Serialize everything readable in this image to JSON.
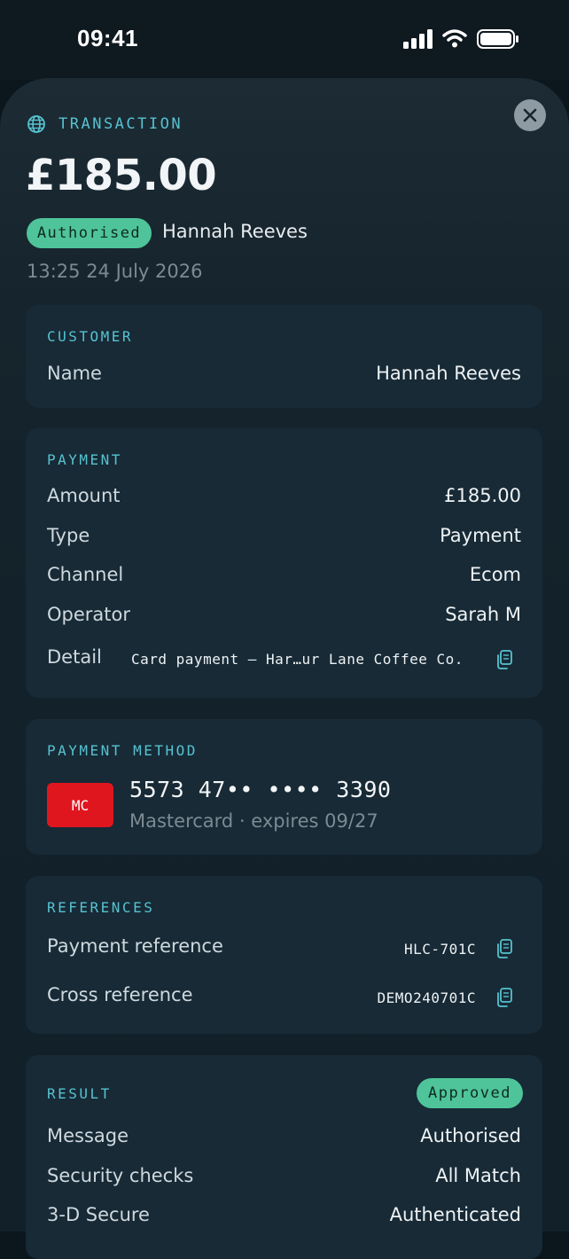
{
  "status_bar": {
    "time": "09:41"
  },
  "header": {
    "label": "TRANSACTION",
    "amount": "£185.00",
    "status_pill": "Authorised",
    "customer_name": "Hannah Reeves",
    "timestamp": "13:25 24 July 2026"
  },
  "customer": {
    "title": "CUSTOMER",
    "rows": [
      {
        "label": "Name",
        "value": "Hannah Reeves"
      }
    ]
  },
  "payment": {
    "title": "PAYMENT",
    "rows": [
      {
        "label": "Amount",
        "value": "£185.00"
      },
      {
        "label": "Type",
        "value": "Payment"
      },
      {
        "label": "Channel",
        "value": "Ecom"
      },
      {
        "label": "Operator",
        "value": "Sarah M"
      }
    ],
    "detail_label": "Detail",
    "detail_value": "Card payment — Har…ur Lane Coffee Co."
  },
  "payment_method": {
    "title": "PAYMENT METHOD",
    "brand_code": "MC",
    "card_number": "5573 47•• •••• 3390",
    "card_subtitle": "Mastercard · expires 09/27"
  },
  "references": {
    "title": "REFERENCES",
    "rows": [
      {
        "label": "Payment reference",
        "value": "HLC-701C"
      },
      {
        "label": "Cross reference",
        "value": "DEMO240701C"
      }
    ]
  },
  "result": {
    "title": "RESULT",
    "badge": "Approved",
    "rows": [
      {
        "label": "Message",
        "value": "Authorised"
      },
      {
        "label": "Security checks",
        "value": "All Match"
      },
      {
        "label": "3-D Secure",
        "value": "Authenticated"
      }
    ]
  },
  "colors": {
    "accent": "#57c2d0",
    "success": "#4fc49a",
    "card_brand": "#e0161f",
    "background": "#0c161d"
  },
  "icons": [
    "globe-icon",
    "close-icon",
    "copy-icon",
    "signal-icon",
    "wifi-icon",
    "battery-icon"
  ]
}
